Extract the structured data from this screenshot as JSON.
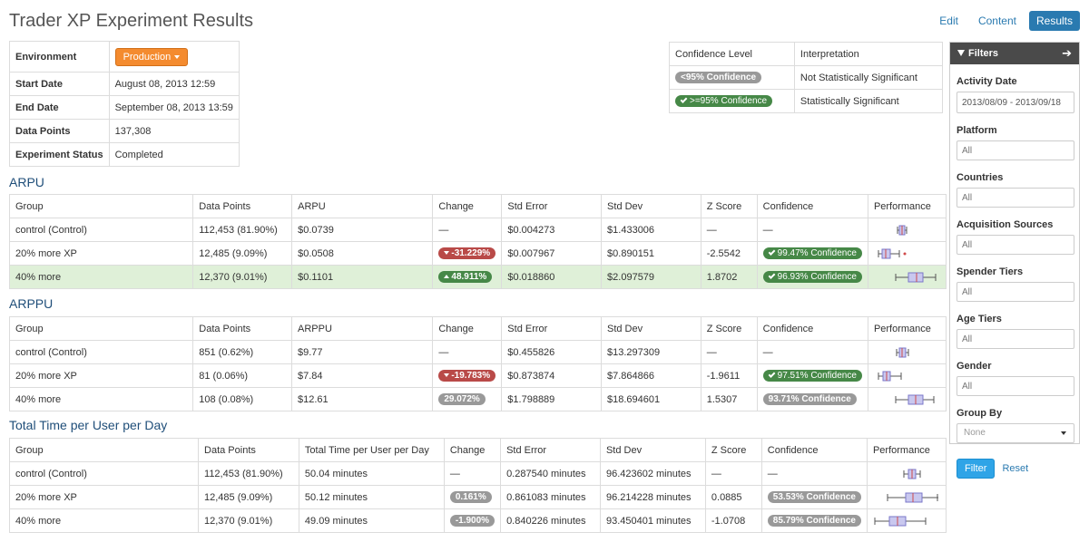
{
  "page": {
    "title": "Trader XP Experiment Results"
  },
  "nav": {
    "edit": "Edit",
    "content": "Content",
    "results": "Results"
  },
  "environment": {
    "label": "Environment",
    "value": "Production",
    "rows": [
      {
        "label": "Start Date",
        "value": "August 08, 2013 12:59"
      },
      {
        "label": "End Date",
        "value": "September 08, 2013 13:59"
      },
      {
        "label": "Data Points",
        "value": "137,308"
      },
      {
        "label": "Experiment Status",
        "value": "Completed"
      }
    ]
  },
  "legend": {
    "headers": [
      "Confidence Level",
      "Interpretation"
    ],
    "rows": [
      {
        "badge": "<95% Confidence",
        "interpretation": "Not Statistically Significant"
      },
      {
        "badge": ">=95% Confidence",
        "interpretation": "Statistically Significant"
      }
    ]
  },
  "arpu": {
    "title": "ARPU",
    "headers": [
      "Group",
      "Data Points",
      "ARPU",
      "Change",
      "Std Error",
      "Std Dev",
      "Z Score",
      "Confidence",
      "Performance"
    ],
    "rows": [
      {
        "group": "control (Control)",
        "points": "112,453 (81.90%)",
        "metric": "$0.0739",
        "change": "—",
        "stderr": "$0.004273",
        "stddev": "$1.433006",
        "z": "—",
        "conf": "—"
      },
      {
        "group": "20% more XP",
        "points": "12,485 (9.09%)",
        "metric": "$0.0508",
        "change": "-31.229%",
        "stderr": "$0.007967",
        "stddev": "$0.890151",
        "z": "-2.5542",
        "conf": "99.47% Confidence"
      },
      {
        "group": "40% more",
        "points": "12,370 (9.01%)",
        "metric": "$0.1101",
        "change": "48.911%",
        "stderr": "$0.018860",
        "stddev": "$2.097579",
        "z": "1.8702",
        "conf": "96.93% Confidence"
      }
    ]
  },
  "arppu": {
    "title": "ARPPU",
    "headers": [
      "Group",
      "Data Points",
      "ARPPU",
      "Change",
      "Std Error",
      "Std Dev",
      "Z Score",
      "Confidence",
      "Performance"
    ],
    "rows": [
      {
        "group": "control (Control)",
        "points": "851 (0.62%)",
        "metric": "$9.77",
        "change": "—",
        "stderr": "$0.455826",
        "stddev": "$13.297309",
        "z": "—",
        "conf": "—"
      },
      {
        "group": "20% more XP",
        "points": "81 (0.06%)",
        "metric": "$7.84",
        "change": "-19.783%",
        "stderr": "$0.873874",
        "stddev": "$7.864866",
        "z": "-1.9611",
        "conf": "97.51% Confidence"
      },
      {
        "group": "40% more",
        "points": "108 (0.08%)",
        "metric": "$12.61",
        "change": "29.072%",
        "stderr": "$1.798889",
        "stddev": "$18.694601",
        "z": "1.5307",
        "conf": "93.71% Confidence"
      }
    ]
  },
  "time": {
    "title": "Total Time per User per Day",
    "headers": [
      "Group",
      "Data Points",
      "Total Time per User per Day",
      "Change",
      "Std Error",
      "Std Dev",
      "Z Score",
      "Confidence",
      "Performance"
    ],
    "rows": [
      {
        "group": "control (Control)",
        "points": "112,453 (81.90%)",
        "metric": "50.04 minutes",
        "change": "—",
        "stderr": "0.287540 minutes",
        "stddev": "96.423602 minutes",
        "z": "—",
        "conf": "—"
      },
      {
        "group": "20% more XP",
        "points": "12,485 (9.09%)",
        "metric": "50.12 minutes",
        "change": "0.161%",
        "stderr": "0.861083 minutes",
        "stddev": "96.214228 minutes",
        "z": "0.0885",
        "conf": "53.53% Confidence"
      },
      {
        "group": "40% more",
        "points": "12,370 (9.01%)",
        "metric": "49.09 minutes",
        "change": "-1.900%",
        "stderr": "0.840226 minutes",
        "stddev": "93.450401 minutes",
        "z": "-1.0708",
        "conf": "85.79% Confidence"
      }
    ]
  },
  "filters": {
    "title": "Filters",
    "activity_date_label": "Activity Date",
    "activity_date_value": "2013/08/09 - 2013/09/18",
    "platform_label": "Platform",
    "countries_label": "Countries",
    "acquisition_label": "Acquisition Sources",
    "spender_label": "Spender Tiers",
    "age_label": "Age Tiers",
    "gender_label": "Gender",
    "all_placeholder": "All",
    "group_by_label": "Group By",
    "group_by_value": "None",
    "filter_button": "Filter",
    "reset_link": "Reset"
  },
  "colors": {
    "accent": "#2a7ab0",
    "environment_button": "#f48b2f",
    "significant": "#468847",
    "negative": "#b94a48",
    "not_significant": "#999999",
    "highlight_row": "#dff0d8",
    "filters_header": "#4a4a4a",
    "filter_button": "#2fa4e7"
  },
  "icons": {
    "dropdown": "caret-down-icon",
    "filters": "funnel-icon",
    "collapse": "arrow-right-icon",
    "significant": "check-icon",
    "increase": "triangle-up-icon",
    "decrease": "triangle-down-icon"
  }
}
